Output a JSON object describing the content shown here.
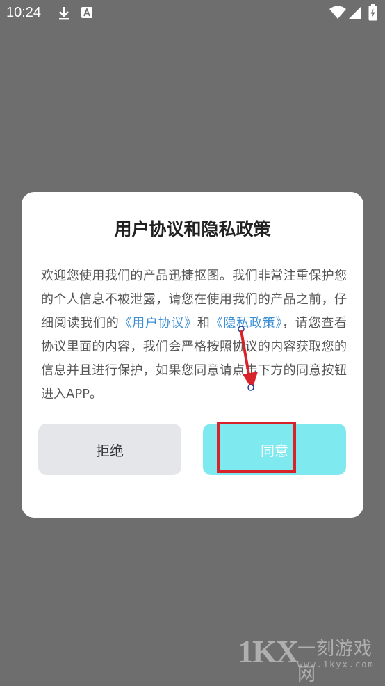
{
  "status_bar": {
    "time": "10:24"
  },
  "dialog": {
    "title": "用户协议和隐私政策",
    "body_part1": "欢迎您使用我们的产品迅捷抠图。我们非常注重保护您的个人信息不被泄露，请您在使用我们的产品之前，仔细阅读我们的",
    "user_agreement_link": "《用户协议》",
    "and_text": "和",
    "privacy_policy_link": "《隐私政策》",
    "body_part2": "，请您查看协议里面的内容，我们会严格按照协议的内容获取您的信息并且进行保护，如果您同意请点击下方的同意按钮进入APP。",
    "reject_label": "拒绝",
    "agree_label": "同意"
  },
  "watermark": {
    "logo_text": "1KX",
    "name": "一刻游戏网",
    "url": "www.1kyx.com"
  },
  "colors": {
    "overlay": "#6e6e6e",
    "link": "#3c8fd6",
    "agree_button": "#7ee9ef",
    "reject_button": "#e4e6ea",
    "annotation": "#d9232b"
  }
}
